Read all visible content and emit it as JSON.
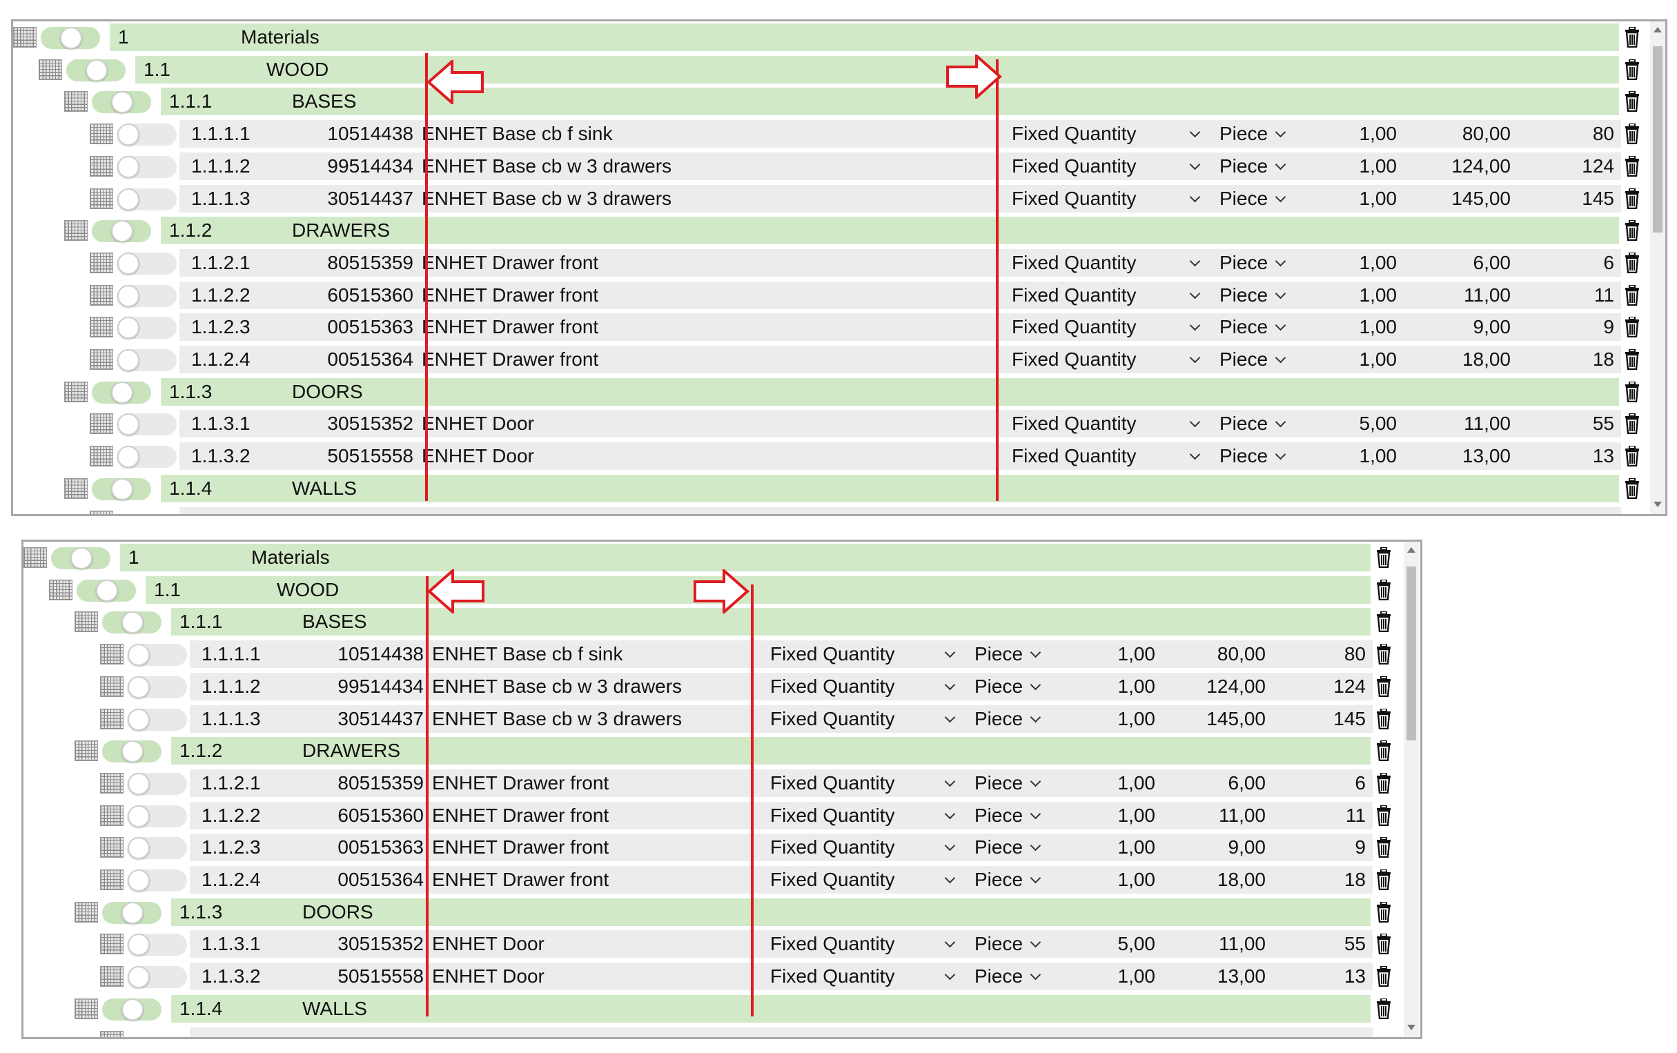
{
  "root": {
    "number": "1",
    "name": "Materials"
  },
  "group": {
    "number": "1.1",
    "name": "WOOD"
  },
  "subgroups": [
    {
      "number": "1.1.1",
      "name": "BASES"
    },
    {
      "number": "1.1.2",
      "name": "DRAWERS"
    },
    {
      "number": "1.1.3",
      "name": "DOORS"
    },
    {
      "number": "1.1.4",
      "name": "WALLS"
    }
  ],
  "items": [
    {
      "number": "1.1.1.1",
      "article": "10514438",
      "description": "ENHET Base cb f sink",
      "quantity_type": "Fixed Quantity",
      "unit": "Piece",
      "quantity": "1,00",
      "price": "80,00",
      "total": "80"
    },
    {
      "number": "1.1.1.2",
      "article": "99514434",
      "description": "ENHET Base cb w 3 drawers",
      "quantity_type": "Fixed Quantity",
      "unit": "Piece",
      "quantity": "1,00",
      "price": "124,00",
      "total": "124"
    },
    {
      "number": "1.1.1.3",
      "article": "30514437",
      "description": "ENHET Base cb w 3 drawers",
      "quantity_type": "Fixed Quantity",
      "unit": "Piece",
      "quantity": "1,00",
      "price": "145,00",
      "total": "145"
    },
    {
      "number": "1.1.2.1",
      "article": "80515359",
      "description": "ENHET Drawer front",
      "quantity_type": "Fixed Quantity",
      "unit": "Piece",
      "quantity": "1,00",
      "price": "6,00",
      "total": "6"
    },
    {
      "number": "1.1.2.2",
      "article": "60515360",
      "description": "ENHET Drawer front",
      "quantity_type": "Fixed Quantity",
      "unit": "Piece",
      "quantity": "1,00",
      "price": "11,00",
      "total": "11"
    },
    {
      "number": "1.1.2.3",
      "article": "00515363",
      "description": "ENHET Drawer front",
      "quantity_type": "Fixed Quantity",
      "unit": "Piece",
      "quantity": "1,00",
      "price": "9,00",
      "total": "9"
    },
    {
      "number": "1.1.2.4",
      "article": "00515364",
      "description": "ENHET Drawer front",
      "quantity_type": "Fixed Quantity",
      "unit": "Piece",
      "quantity": "1,00",
      "price": "18,00",
      "total": "18"
    },
    {
      "number": "1.1.3.1",
      "article": "30515352",
      "description": "ENHET Door",
      "quantity_type": "Fixed Quantity",
      "unit": "Piece",
      "quantity": "5,00",
      "price": "11,00",
      "total": "55"
    },
    {
      "number": "1.1.3.2",
      "article": "50515558",
      "description": "ENHET Door",
      "quantity_type": "Fixed Quantity",
      "unit": "Piece",
      "quantity": "1,00",
      "price": "13,00",
      "total": "13"
    }
  ],
  "icons": {
    "drag": "drag-handle-icon",
    "delete": "trash-icon",
    "dropdown": "chevron-down-icon"
  },
  "colors": {
    "group_background": "#d2e9c7",
    "item_background": "#ececec",
    "annotation": "#e01b22"
  }
}
